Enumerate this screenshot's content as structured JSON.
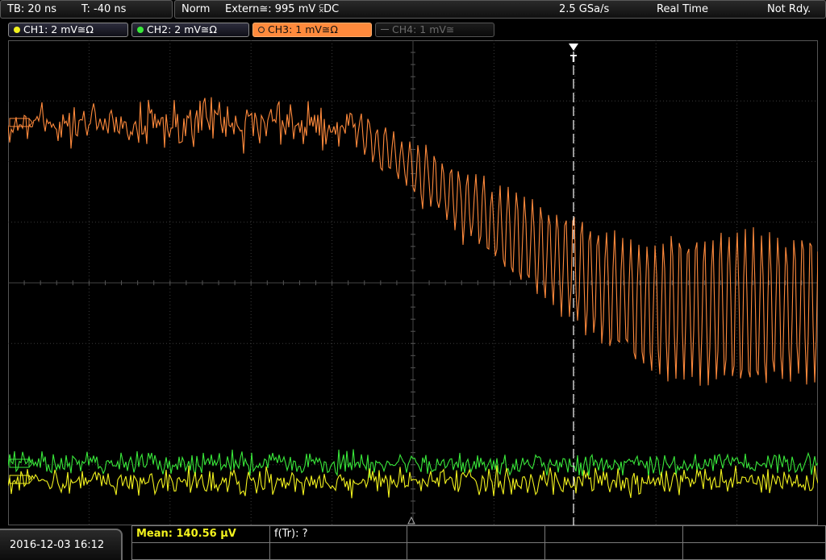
{
  "topbar": {
    "timebase": "TB: 20 ns",
    "trigger_pos": "T: -40 ns",
    "trigger_mode": "Norm",
    "trigger_source": "Extern≅: 995 mV ⫁DC",
    "sample_rate": "2.5 GSa/s",
    "acq_mode": "Real Time",
    "status": "Not Rdy."
  },
  "channels": [
    {
      "label": "CH1: 2 mV≅Ω",
      "color": "#f2f21e",
      "active": true
    },
    {
      "label": "CH2: 2 mV≅Ω",
      "color": "#39e83a",
      "active": true
    },
    {
      "label": "CH3: 1 mV≅Ω",
      "color": "#ff8a3c",
      "active": true,
      "selected": true
    },
    {
      "label": "CH4: 1 mV≅",
      "color": "#6b6b6b",
      "active": false
    }
  ],
  "trigger_marker": "T",
  "measurements": {
    "mean": "Mean: 140.56 µV",
    "rise": "f(Tr): ?"
  },
  "datetime": "2016-12-03 16:12",
  "colors": {
    "ch1": "#f2f21e",
    "ch2": "#39e83a",
    "ch3": "#ff8a3c",
    "grid": "#3a3a3a",
    "background": "#000000"
  }
}
